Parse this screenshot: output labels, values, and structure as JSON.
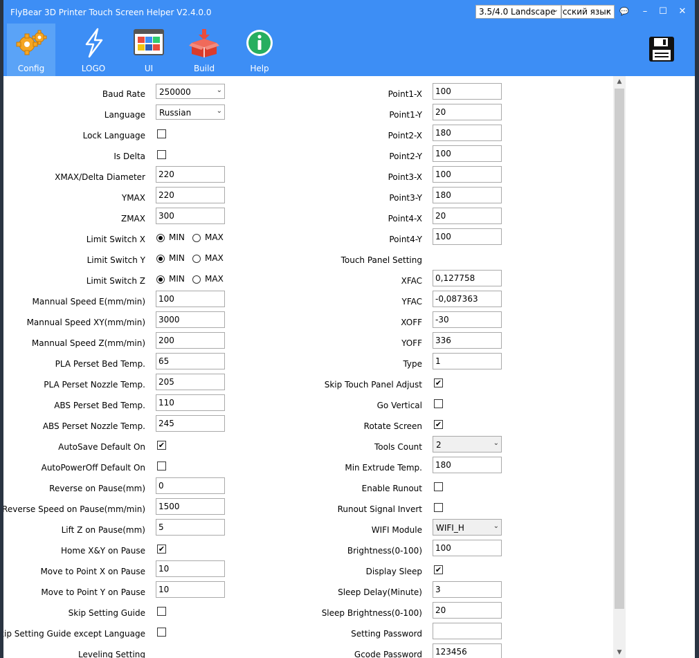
{
  "title": "FlyBear 3D Printer Touch Screen Helper  V2.4.0.0",
  "orientation_select": "3.5/4.0 Landscape",
  "ui_language_select": "Русский язык",
  "window_buttons": {
    "help": "💬",
    "minimize": "–",
    "maximize": "☐",
    "close": "✕"
  },
  "toolbar": [
    {
      "label": "Config",
      "icon": "gear-icon",
      "active": true
    },
    {
      "label": "LOGO",
      "icon": "lightning-icon",
      "active": false
    },
    {
      "label": "UI",
      "icon": "window-tiles-icon",
      "active": false
    },
    {
      "label": "Build",
      "icon": "box-icon",
      "active": false
    },
    {
      "label": "Help",
      "icon": "info-icon",
      "active": false
    }
  ],
  "save_icon": "floppy-disk-icon",
  "left": {
    "baud_rate": {
      "label": "Baud Rate",
      "value": "250000"
    },
    "language": {
      "label": "Language",
      "value": "Russian"
    },
    "lock_language": {
      "label": "Lock Language",
      "checked": ""
    },
    "is_delta": {
      "label": "Is Delta",
      "checked": ""
    },
    "xmax": {
      "label": "XMAX/Delta Diameter",
      "value": "220"
    },
    "ymax": {
      "label": "YMAX",
      "value": "220"
    },
    "zmax": {
      "label": "ZMAX",
      "value": "300"
    },
    "limit_x": {
      "label": "Limit Switch X",
      "min": "MIN",
      "max": "MAX"
    },
    "limit_y": {
      "label": "Limit Switch Y",
      "min": "MIN",
      "max": "MAX"
    },
    "limit_z": {
      "label": "Limit Switch Z",
      "min": "MIN",
      "max": "MAX"
    },
    "speed_e": {
      "label": "Mannual Speed E(mm/min)",
      "value": "100"
    },
    "speed_xy": {
      "label": "Mannual Speed XY(mm/min)",
      "value": "3000"
    },
    "speed_z": {
      "label": "Mannual Speed Z(mm/min)",
      "value": "200"
    },
    "pla_bed": {
      "label": "PLA Perset Bed Temp.",
      "value": "65"
    },
    "pla_nozzle": {
      "label": "PLA Perset Nozzle Temp.",
      "value": "205"
    },
    "abs_bed": {
      "label": "ABS Perset Bed Temp.",
      "value": "110"
    },
    "abs_nozzle": {
      "label": "ABS Perset Nozzle Temp.",
      "value": "245"
    },
    "autosave": {
      "label": "AutoSave Default On",
      "checked": "✔"
    },
    "autopoweroff": {
      "label": "AutoPowerOff Default On",
      "checked": ""
    },
    "reverse_pause": {
      "label": "Reverse on Pause(mm)",
      "value": "0"
    },
    "reverse_speed_pause": {
      "label": "Reverse Speed on Pause(mm/min)",
      "value": "1500"
    },
    "lift_z_pause": {
      "label": "Lift Z on Pause(mm)",
      "value": "5"
    },
    "home_xy_pause": {
      "label": "Home X&Y on Pause",
      "checked": "✔"
    },
    "move_x_pause": {
      "label": "Move to Point X on Pause",
      "value": "10"
    },
    "move_y_pause": {
      "label": "Move to Point Y on Pause",
      "value": "10"
    },
    "skip_guide": {
      "label": "Skip Setting Guide",
      "checked": ""
    },
    "skip_guide_except_lang": {
      "label": "Skip Setting Guide except Language",
      "checked": ""
    },
    "leveling_setting": {
      "label": "Leveling Setting"
    }
  },
  "right": {
    "p1x": {
      "label": "Point1-X",
      "value": "100"
    },
    "p1y": {
      "label": "Point1-Y",
      "value": "20"
    },
    "p2x": {
      "label": "Point2-X",
      "value": "180"
    },
    "p2y": {
      "label": "Point2-Y",
      "value": "100"
    },
    "p3x": {
      "label": "Point3-X",
      "value": "100"
    },
    "p3y": {
      "label": "Point3-Y",
      "value": "180"
    },
    "p4x": {
      "label": "Point4-X",
      "value": "20"
    },
    "p4y": {
      "label": "Point4-Y",
      "value": "100"
    },
    "touch_panel_setting": {
      "label": "Touch Panel Setting"
    },
    "xfac": {
      "label": "XFAC",
      "value": "0,127758"
    },
    "yfac": {
      "label": "YFAC",
      "value": "-0,087363"
    },
    "xoff": {
      "label": "XOFF",
      "value": "-30"
    },
    "yoff": {
      "label": "YOFF",
      "value": "336"
    },
    "type": {
      "label": "Type",
      "value": "1"
    },
    "skip_touch_adjust": {
      "label": "Skip Touch Panel Adjust",
      "checked": "✔"
    },
    "go_vertical": {
      "label": "Go Vertical",
      "checked": ""
    },
    "rotate_screen": {
      "label": "Rotate Screen",
      "checked": "✔"
    },
    "tools_count": {
      "label": "Tools Count",
      "value": "2"
    },
    "min_extrude": {
      "label": "Min Extrude Temp.",
      "value": "180"
    },
    "enable_runout": {
      "label": "Enable Runout",
      "checked": ""
    },
    "runout_invert": {
      "label": "Runout Signal Invert",
      "checked": ""
    },
    "wifi_module": {
      "label": "WIFI Module",
      "value": "WIFI_H"
    },
    "brightness": {
      "label": "Brightness(0-100)",
      "value": "100"
    },
    "display_sleep": {
      "label": "Display Sleep",
      "checked": "✔"
    },
    "sleep_delay": {
      "label": "Sleep Delay(Minute)",
      "value": "3"
    },
    "sleep_brightness": {
      "label": "Sleep Brightness(0-100)",
      "value": "20"
    },
    "setting_password": {
      "label": "Setting Password",
      "value": ""
    },
    "gcode_password": {
      "label": "Gcode Password",
      "value": "123456"
    }
  }
}
